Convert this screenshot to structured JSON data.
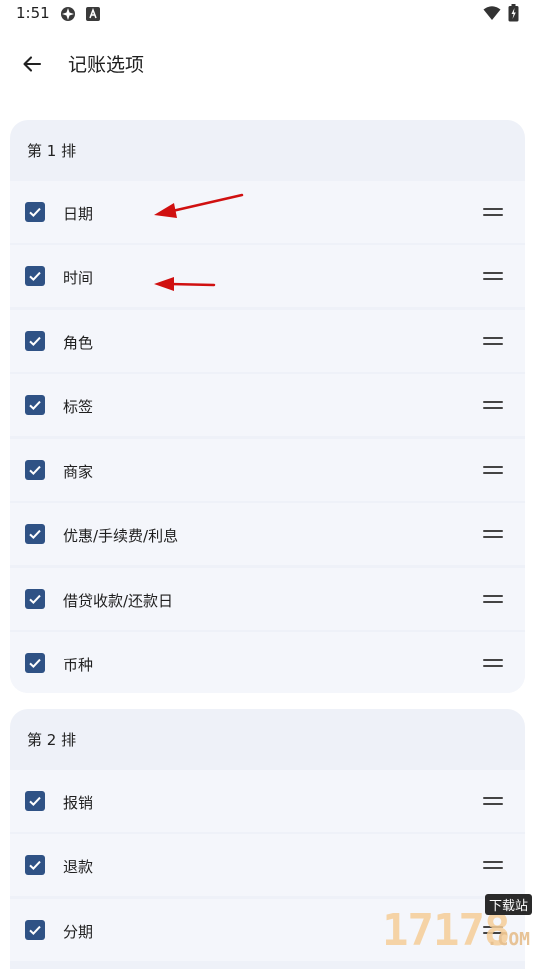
{
  "status_bar": {
    "time": "1:51"
  },
  "header": {
    "title": "记账选项"
  },
  "groups": [
    {
      "title": "第 1 排",
      "items": [
        {
          "label": "日期",
          "checked": true
        },
        {
          "label": "时间",
          "checked": true
        },
        {
          "label": "角色",
          "checked": true
        },
        {
          "label": "标签",
          "checked": true
        },
        {
          "label": "商家",
          "checked": true
        },
        {
          "label": "优惠/手续费/利息",
          "checked": true
        },
        {
          "label": "借贷收款/还款日",
          "checked": true
        },
        {
          "label": "币种",
          "checked": true
        }
      ]
    },
    {
      "title": "第 2 排",
      "items": [
        {
          "label": "报销",
          "checked": true
        },
        {
          "label": "退款",
          "checked": true
        },
        {
          "label": "分期",
          "checked": true
        }
      ]
    }
  ],
  "colors": {
    "checkbox": "#2f5285",
    "card_bg": "#eef1f8",
    "annotation_arrow": "#d01010"
  },
  "watermark": {
    "number": "17178",
    "tag": "下载站",
    "domain": ".COM"
  }
}
